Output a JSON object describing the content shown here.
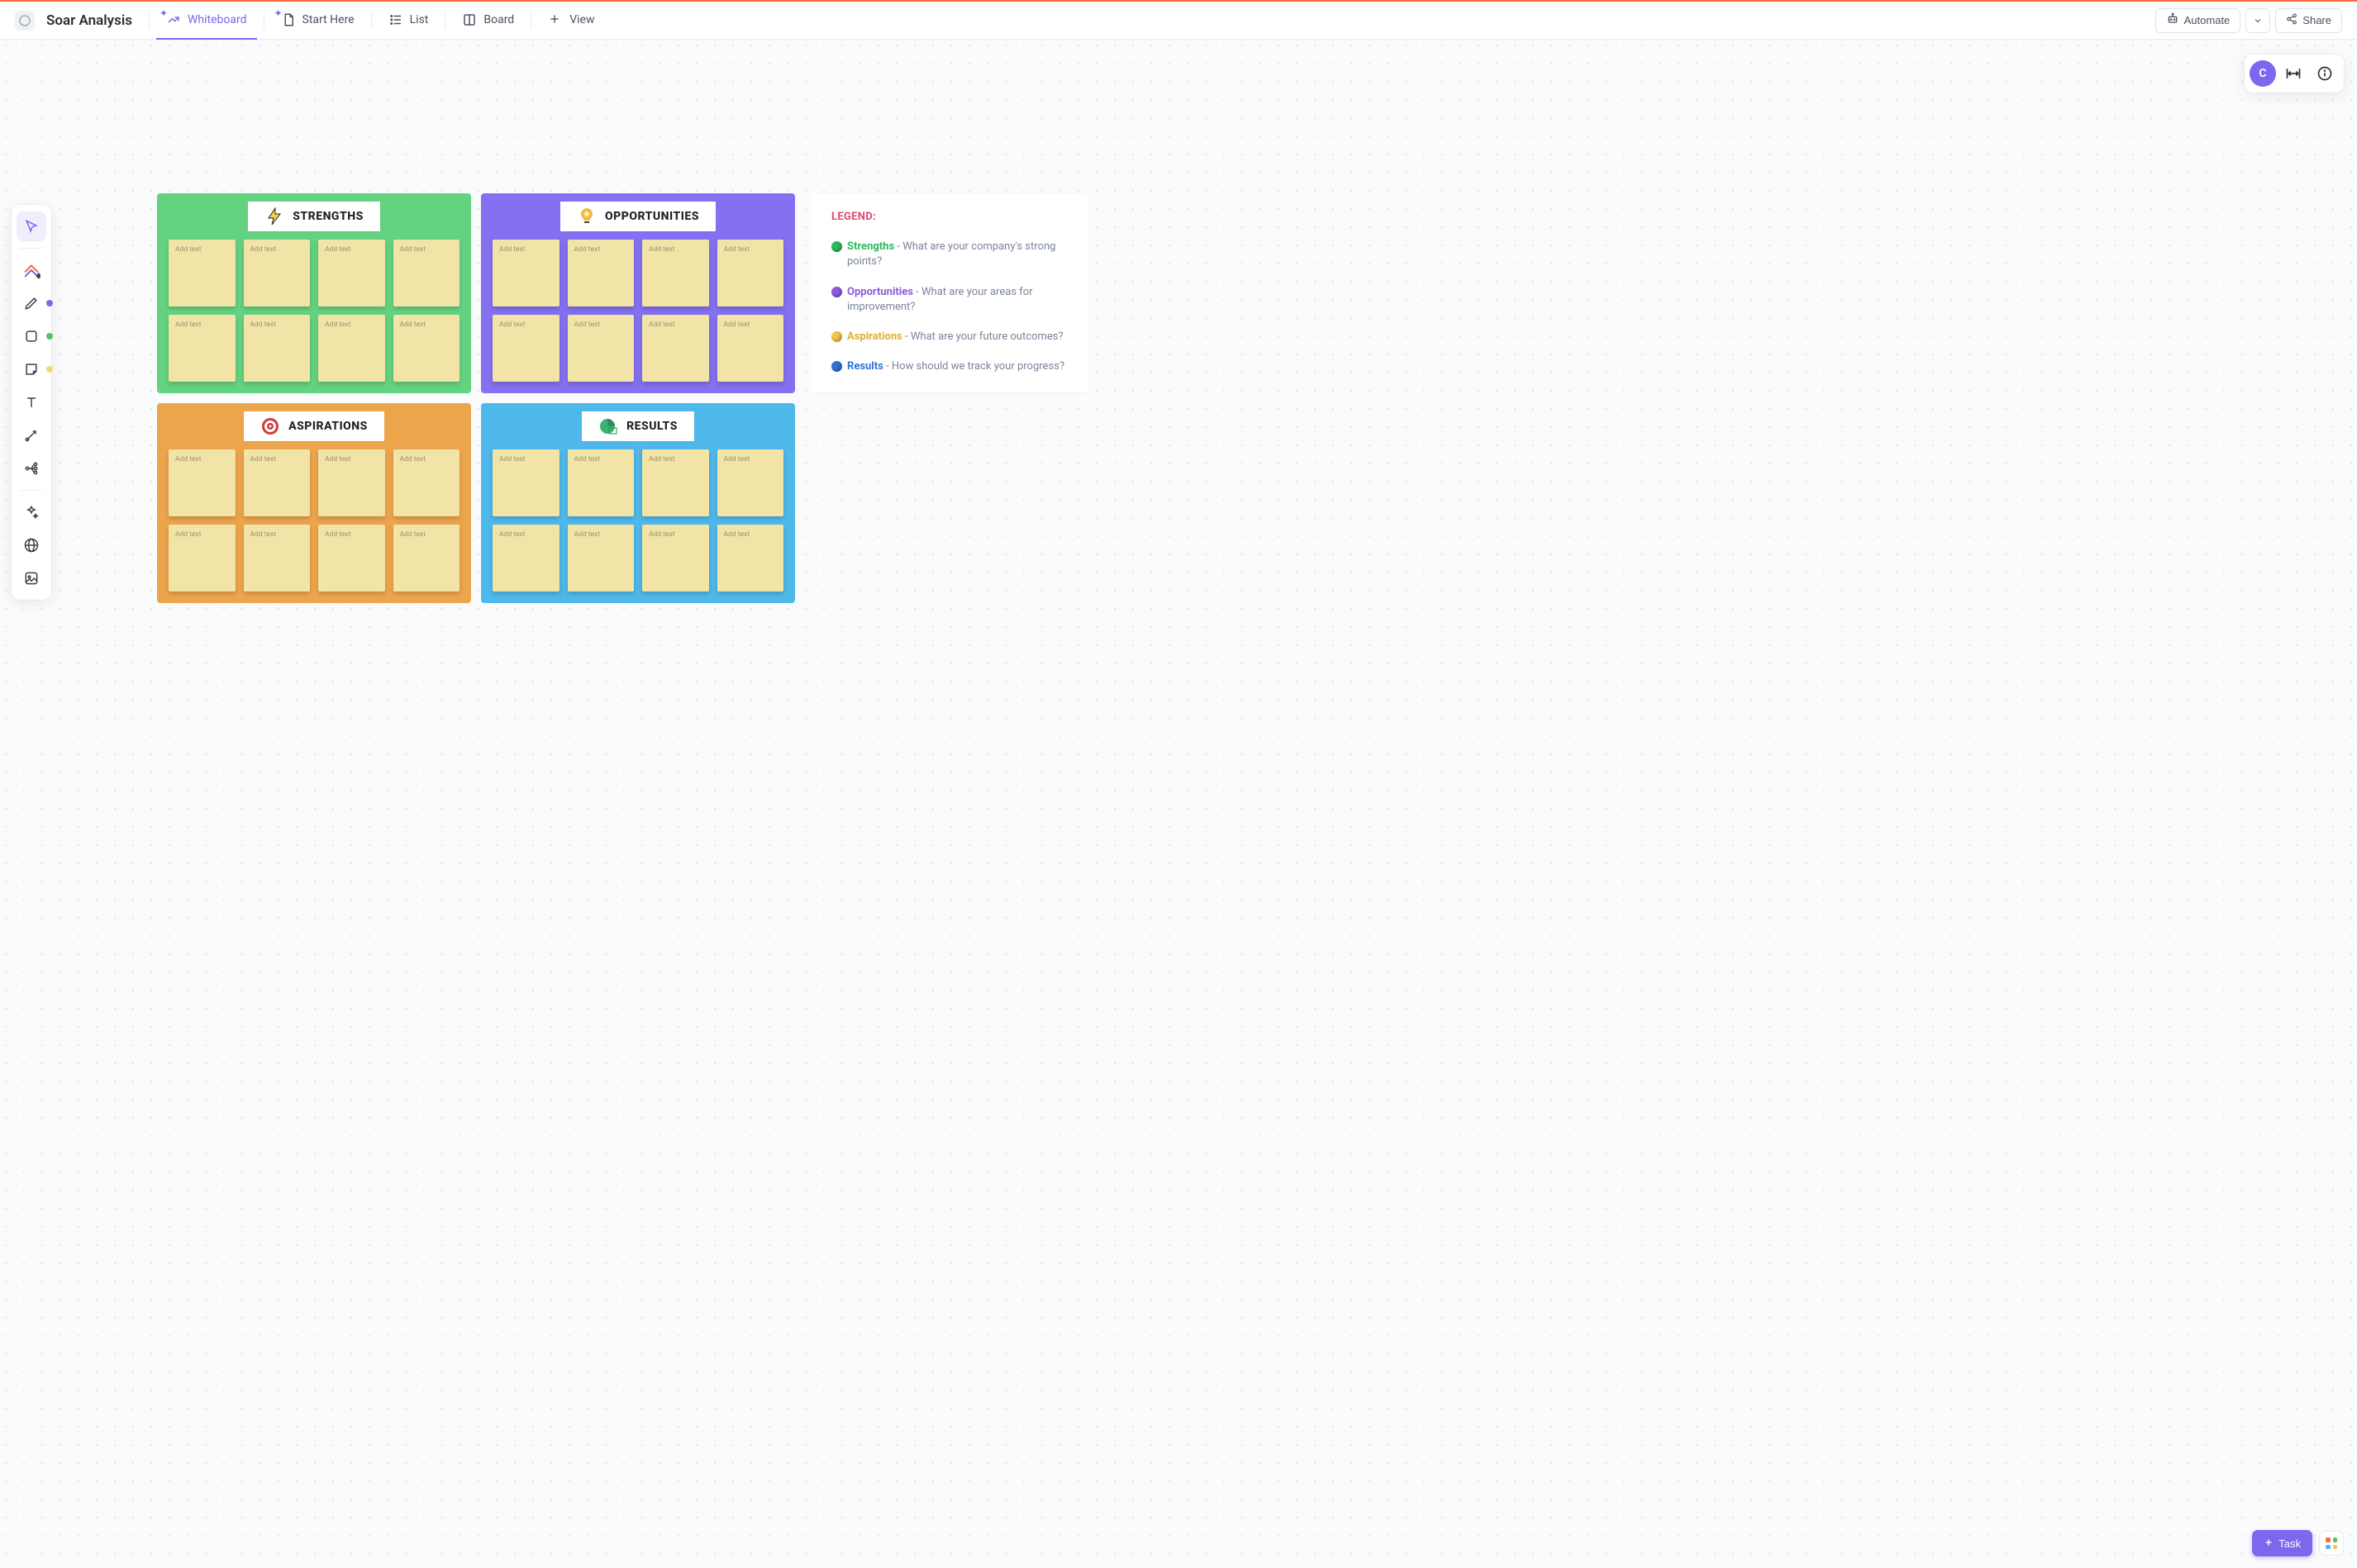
{
  "header": {
    "title": "Soar Analysis",
    "tabs": [
      {
        "label": "Whiteboard",
        "starred": true,
        "active": true,
        "icon": "whiteboard"
      },
      {
        "label": "Start Here",
        "starred": true,
        "active": false,
        "icon": "doc"
      },
      {
        "label": "List",
        "starred": false,
        "active": false,
        "icon": "list"
      },
      {
        "label": "Board",
        "starred": false,
        "active": false,
        "icon": "board"
      },
      {
        "label": "View",
        "starred": false,
        "active": false,
        "icon": "plus"
      }
    ],
    "automate_label": "Automate",
    "share_label": "Share"
  },
  "user": {
    "initial": "C"
  },
  "toolbar": {
    "items": [
      {
        "name": "select-tool",
        "active": true
      },
      {
        "name": "hierarchy-tool"
      },
      {
        "name": "pen-tool",
        "dot": "pu"
      },
      {
        "name": "shape-tool",
        "dot": "gr"
      },
      {
        "name": "sticky-tool",
        "dot": "ye"
      },
      {
        "name": "text-tool"
      },
      {
        "name": "connector-tool"
      },
      {
        "name": "mindmap-tool"
      },
      {
        "name": "ai-tool"
      },
      {
        "name": "web-tool"
      },
      {
        "name": "image-tool"
      }
    ]
  },
  "panels": {
    "strengths": {
      "title": "STRENGTHS",
      "note_placeholder": "Add text"
    },
    "opportunities": {
      "title": "OPPORTUNITIES",
      "note_placeholder": "Add text"
    },
    "aspirations": {
      "title": "ASPIRATIONS",
      "note_placeholder": "Add text"
    },
    "results": {
      "title": "RESULTS",
      "note_placeholder": "Add text"
    }
  },
  "legend": {
    "title": "LEGEND:",
    "rows": [
      {
        "key": "Strengths",
        "dash": " - ",
        "text": "What are your company's strong points?",
        "cls": "g"
      },
      {
        "key": "Opportunities",
        "dash": " - ",
        "text": "What are your areas for improvement?",
        "cls": "p"
      },
      {
        "key": "Aspirations",
        "dash": " - ",
        "text": "What are your future outcomes?",
        "cls": "y"
      },
      {
        "key": "Results",
        "dash": " - ",
        "text": "How should we track your progress?",
        "cls": "b"
      }
    ]
  },
  "task_button": {
    "label": "Task"
  }
}
